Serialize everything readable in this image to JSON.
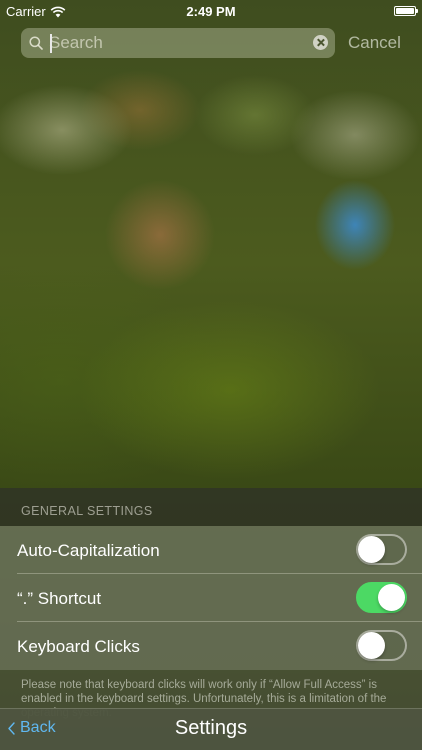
{
  "status_bar": {
    "carrier": "Carrier",
    "time": "2:49 PM",
    "wifi_icon": "wifi-icon",
    "battery_icon": "battery-icon"
  },
  "search": {
    "placeholder": "Search",
    "value": "",
    "search_icon": "magnifying-glass",
    "clear_icon": "clear-circle-x",
    "cancel_label": "Cancel"
  },
  "settings": {
    "section_header": "GENERAL SETTINGS",
    "rows": [
      {
        "label": "Auto-Capitalization",
        "toggle_on": false
      },
      {
        "label": "“.” Shortcut",
        "toggle_on": true
      },
      {
        "label": "Keyboard Clicks",
        "toggle_on": false
      }
    ],
    "footnote": "Please note that keyboard clicks will work only if “Allow Full Access” is enabled in the keyboard settings. Unfortunately, this is a limitation of the operating system."
  },
  "nav_bar": {
    "back_label": "Back",
    "title": "Settings",
    "back_icon": "chevron-left"
  },
  "colors": {
    "accent_blue": "#60b8f0",
    "toggle_on_green": "#4cd964"
  }
}
